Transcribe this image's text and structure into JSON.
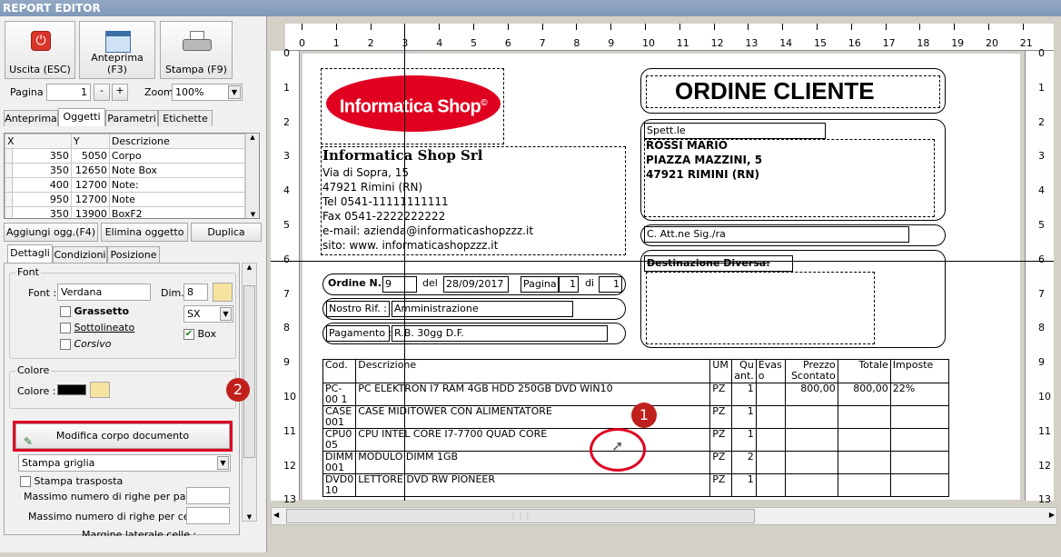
{
  "window": {
    "title": "REPORT EDITOR"
  },
  "toolbar": {
    "exit_label": "Uscita (ESC)",
    "preview_label": "Anteprima (F3)",
    "print_label": "Stampa (F9)",
    "page_label": "Pagina",
    "page_value": "1",
    "minus": "-",
    "plus": "+",
    "zoom_label": "Zoom",
    "zoom_value": "100%"
  },
  "tabs_top": [
    "Anteprima",
    "Oggetti",
    "Parametri",
    "Etichette"
  ],
  "objects_grid": {
    "headers": [
      "X",
      "Y",
      "Descrizione"
    ],
    "rows": [
      [
        "350",
        "5050",
        "Corpo"
      ],
      [
        "350",
        "12650",
        "Note Box"
      ],
      [
        "400",
        "12700",
        "Note:"
      ],
      [
        "950",
        "12700",
        "Note"
      ],
      [
        "350",
        "13900",
        "BoxF2"
      ]
    ]
  },
  "object_buttons": {
    "add": "Aggiungi ogg.(F4)",
    "delete": "Elimina oggetto",
    "duplicate": "Duplica"
  },
  "tabs_detail": [
    "Dettagli",
    "Condizioni",
    "Posizione"
  ],
  "font_group": {
    "title": "Font",
    "font_label": "Font :",
    "font_value": "Verdana",
    "dim_label": "Dim.",
    "dim_value": "8",
    "bold": "Grassetto",
    "underline": "Sottolineato",
    "italic": "Corsivo",
    "align_value": "SX",
    "box_label": "Box"
  },
  "color_group": {
    "title": "Colore",
    "color_label": "Colore :"
  },
  "edit_body_button": "Modifica corpo documento",
  "print_mode_value": "Stampa griglia",
  "transposed_label": "Stampa trasposta",
  "max_rows_page": "Massimo numero di righe per pagina :",
  "max_rows_cell": "Massimo numero di righe per cella :",
  "cell_margin": "Margine laterale celle :",
  "markers": {
    "one": "1",
    "two": "2"
  },
  "ruler": {
    "h_ticks": [
      "0",
      "1",
      "2",
      "3",
      "4",
      "5",
      "6",
      "7",
      "8",
      "9",
      "10",
      "11",
      "12",
      "13",
      "14",
      "15",
      "16",
      "17",
      "18",
      "19",
      "20",
      "21"
    ],
    "v_ticks": [
      "0",
      "1",
      "2",
      "3",
      "4",
      "5",
      "6",
      "7",
      "8",
      "9",
      "10",
      "11",
      "12",
      "13"
    ]
  },
  "document": {
    "logo_text": "Informatica Shop",
    "logo_mark": "©",
    "doc_title": "ORDINE CLIENTE",
    "company_name": "Informatica Shop Srl",
    "company_lines": [
      "Via di Sopra, 15",
      "47921 Rimini (RN)",
      "Tel 0541-11111111111",
      "Fax 0541-2222222222",
      "e-mail: azienda@informaticashopzzz.it",
      "sito: www. informaticashopzzz.it"
    ],
    "spett_label": "Spett.le",
    "customer_lines": [
      "ROSSI MARIO",
      "PIAZZA MAZZINI, 5",
      "47921 RIMINI (RN)"
    ],
    "att_label": "C. Att.ne Sig./ra",
    "dest_label": "Destinazione Diversa:",
    "order_label": "Ordine N.",
    "order_value": "9",
    "del_label": "del",
    "date_value": "28/09/2017",
    "page_label": "Pagina",
    "page_value": "1",
    "of_label": "di",
    "of_value": "1",
    "ref_label": "Nostro Rif. :",
    "ref_value": "Amministrazione",
    "pay_label": "Pagamento :",
    "pay_value": "R.B. 30gg D.F."
  },
  "order_table": {
    "headers": [
      "Cod.",
      "Descrizione",
      "UM",
      "Qu ant.",
      "Evas o",
      "Prezzo Scontato",
      "Totale",
      "Imposte"
    ],
    "rows": [
      [
        "PC-00 1",
        "PC ELEKTRON I7 RAM 4GB HDD 250GB DVD WIN10",
        "PZ",
        "1",
        "",
        "800,00",
        "800,00",
        "22%"
      ],
      [
        "CASE 001",
        "CASE MIDITOWER CON ALIMENTATORE",
        "PZ",
        "1",
        "",
        "",
        "",
        ""
      ],
      [
        "CPU0 05",
        "CPU INTEL CORE I7-7700 QUAD CORE",
        "PZ",
        "1",
        "",
        "",
        "",
        ""
      ],
      [
        "DIMM 001",
        "MODULO DIMM 1GB",
        "PZ",
        "2",
        "",
        "",
        "",
        ""
      ],
      [
        "DVD0 10",
        "LETTORE DVD RW PIONEER",
        "PZ",
        "1",
        "",
        "",
        "",
        ""
      ]
    ]
  },
  "colors": {
    "accent_red": "#e00020",
    "marker_red": "#c0201c"
  }
}
